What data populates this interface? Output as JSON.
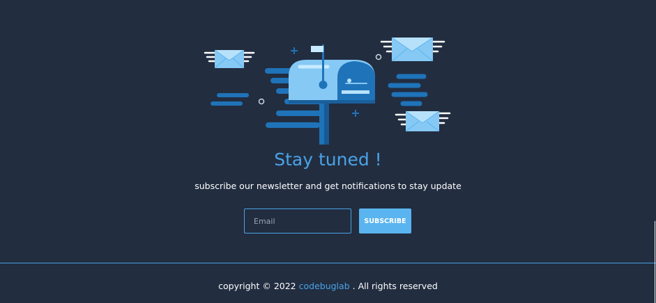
{
  "newsletter": {
    "illustration_icon": "mailbox-with-envelopes-icon",
    "title": "Stay tuned !",
    "subtitle": "subscribe our newsletter and get notifications to stay update",
    "email_placeholder": "Email",
    "email_value": "",
    "subscribe_label": "SUBSCRIBE"
  },
  "footer": {
    "copyright_prefix": "copyright © 2022",
    "brand": "codebuglab",
    "copyright_suffix": ". All rights reserved"
  },
  "colors": {
    "background": "#222d40",
    "accent": "#4aa3e6",
    "button": "#5ab4ef",
    "text": "#ffffff"
  }
}
